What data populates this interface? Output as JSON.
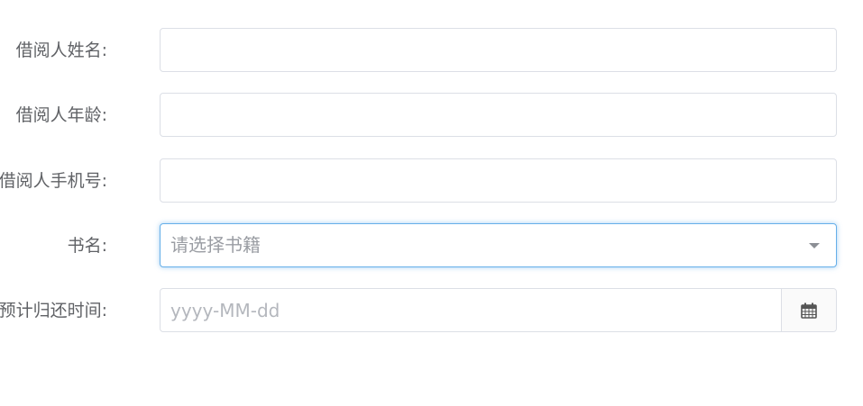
{
  "form": {
    "borrower_name": {
      "label": "借阅人姓名:",
      "value": "",
      "placeholder": ""
    },
    "borrower_age": {
      "label": "借阅人年龄:",
      "value": "",
      "placeholder": ""
    },
    "borrower_phone": {
      "label": "借阅人手机号:",
      "value": "",
      "placeholder": ""
    },
    "book_name": {
      "label": "书名:",
      "placeholder": "请选择书籍",
      "icon": "chevron-down-icon"
    },
    "return_date": {
      "label": "预计归还时间:",
      "value": "",
      "placeholder": "yyyy-MM-dd",
      "icon": "calendar-icon"
    }
  },
  "colors": {
    "label": "#606266",
    "border": "#dcdfe6",
    "focus_border": "#66afe9",
    "placeholder": "#b4b7bd"
  }
}
